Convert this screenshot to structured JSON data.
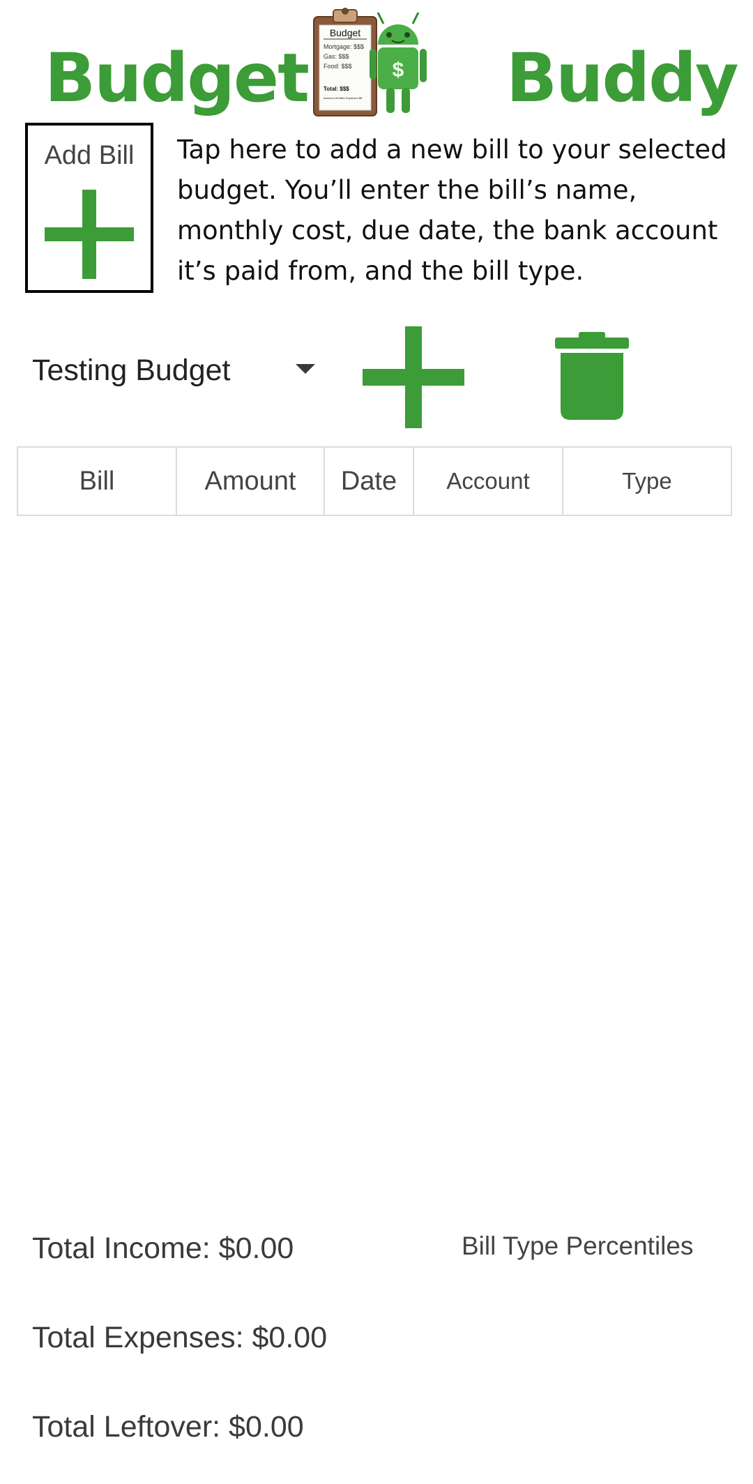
{
  "header": {
    "brand_left": "Budget",
    "brand_right": "Buddy",
    "logo": {
      "clipboard_title": "Budget",
      "lines": [
        "Mortgage: $$$",
        "Gas:        $$$",
        "Food:       $$$"
      ],
      "total": "Total: $$$",
      "footer": "Amount Left After Expenses $$",
      "android_symbol": "$"
    }
  },
  "tutorial": {
    "add_bill_label": "Add Bill",
    "description": "Tap here to add a new bill to your selected budget. You’ll enter the bill’s name, monthly cost, due date, the bank account it’s paid from, and the bill type."
  },
  "controls": {
    "selected_budget": "Testing Budget",
    "add_icon": "plus-icon",
    "delete_icon": "trash-icon"
  },
  "table": {
    "columns": [
      "Bill",
      "Amount",
      "Date",
      "Account",
      "Type"
    ],
    "rows": []
  },
  "totals": {
    "income": "Total Income: $0.00",
    "expenses": "Total Expenses: $0.00",
    "leftover": "Total Leftover: $0.00",
    "bill_type_percentiles": "Bill Type Percentiles"
  },
  "colors": {
    "brand_green": "#3c9c37",
    "border": "#dcdcdc",
    "text": "#3a3a3a"
  }
}
